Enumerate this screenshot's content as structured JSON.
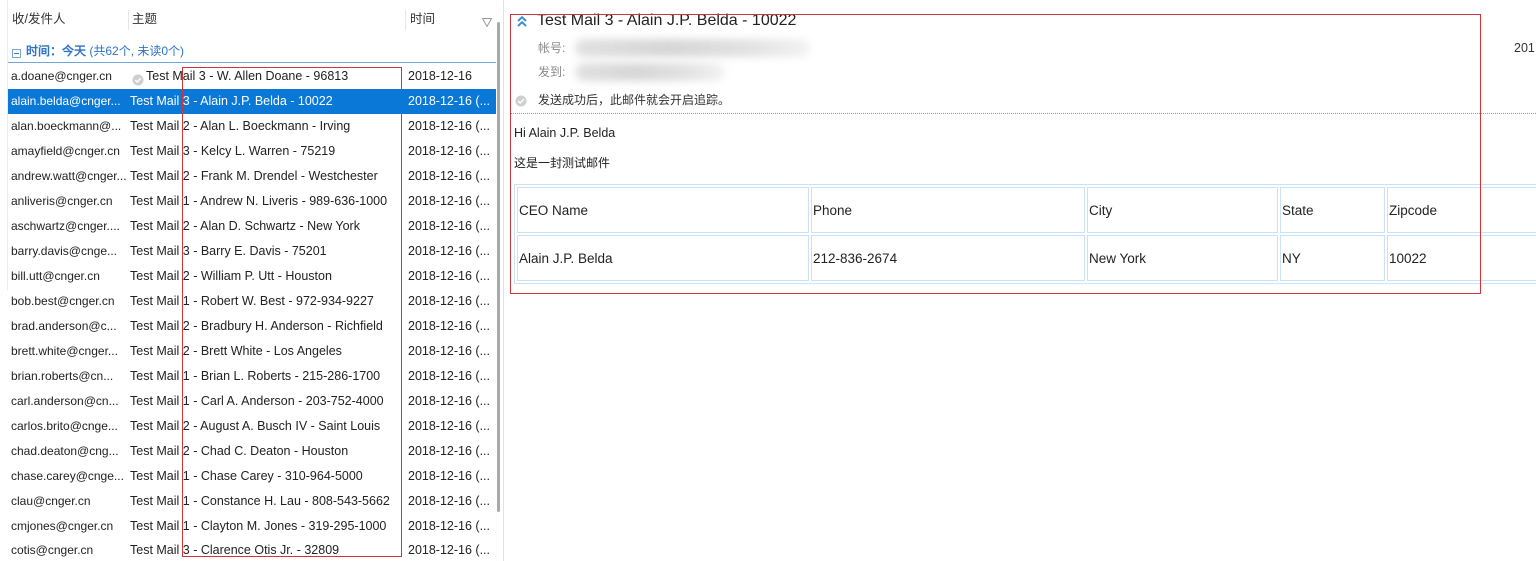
{
  "list": {
    "columns": {
      "sender": "收/发件人",
      "subject": "主题",
      "time": "时间"
    },
    "group": {
      "label": "时间：今天",
      "summary": " (共62个, 未读0个)"
    },
    "rows": [
      {
        "sender": "a.doane@cnger.cn",
        "subject": "Test Mail 3 - W. Allen Doane - 96813",
        "time": "2018-12-16"
      },
      {
        "sender": "alain.belda@cnger...",
        "subject": "Test Mail 3 - Alain J.P. Belda - 10022",
        "time": "2018-12-16 (...",
        "selected": true
      },
      {
        "sender": "alan.boeckmann@...",
        "subject": "Test Mail 2 - Alan L. Boeckmann - Irving",
        "time": "2018-12-16 (..."
      },
      {
        "sender": "amayfield@cnger.cn",
        "subject": "Test Mail 3 - Kelcy L. Warren - 75219",
        "time": "2018-12-16 (..."
      },
      {
        "sender": "andrew.watt@cnger...",
        "subject": "Test Mail 2 - Frank M. Drendel - Westchester",
        "time": "2018-12-16 (..."
      },
      {
        "sender": "anliveris@cnger.cn",
        "subject": "Test Mail 1 - Andrew N. Liveris - 989-636-1000",
        "time": "2018-12-16 (..."
      },
      {
        "sender": "aschwartz@cnger....",
        "subject": "Test Mail 2 - Alan D. Schwartz - New York",
        "time": "2018-12-16 (..."
      },
      {
        "sender": "barry.davis@cnge...",
        "subject": "Test Mail 3 - Barry E. Davis - 75201",
        "time": "2018-12-16 (..."
      },
      {
        "sender": "bill.utt@cnger.cn",
        "subject": "Test Mail 2 - William P. Utt - Houston",
        "time": "2018-12-16 (..."
      },
      {
        "sender": "bob.best@cnger.cn",
        "subject": "Test Mail 1 - Robert W. Best - 972-934-9227",
        "time": "2018-12-16 (..."
      },
      {
        "sender": "brad.anderson@c...",
        "subject": "Test Mail 2 - Bradbury H. Anderson - Richfield",
        "time": "2018-12-16 (..."
      },
      {
        "sender": "brett.white@cnger...",
        "subject": "Test Mail 2 - Brett White - Los Angeles",
        "time": "2018-12-16 (..."
      },
      {
        "sender": "brian.roberts@cn...",
        "subject": "Test Mail 1 - Brian L. Roberts - 215-286-1700",
        "time": "2018-12-16 (..."
      },
      {
        "sender": "carl.anderson@cn...",
        "subject": "Test Mail 1 - Carl A. Anderson - 203-752-4000",
        "time": "2018-12-16 (..."
      },
      {
        "sender": "carlos.brito@cnge...",
        "subject": "Test Mail 2 - August A. Busch IV - Saint Louis",
        "time": "2018-12-16 (..."
      },
      {
        "sender": "chad.deaton@cng...",
        "subject": "Test Mail 2 - Chad C. Deaton - Houston",
        "time": "2018-12-16 (..."
      },
      {
        "sender": "chase.carey@cnge...",
        "subject": "Test Mail 1 - Chase Carey - 310-964-5000",
        "time": "2018-12-16 (..."
      },
      {
        "sender": "clau@cnger.cn",
        "subject": "Test Mail 1 - Constance H. Lau - 808-543-5662",
        "time": "2018-12-16 (..."
      },
      {
        "sender": "cmjones@cnger.cn",
        "subject": "Test Mail 1 - Clayton M. Jones - 319-295-1000",
        "time": "2018-12-16 (..."
      },
      {
        "sender": "cotis@cnger.cn",
        "subject": "Test Mail 3 - Clarence Otis Jr. - 32809",
        "time": "2018-12-16 (..."
      }
    ]
  },
  "reader": {
    "title": "Test Mail 3 - Alain J.P. Belda - 10022",
    "account_label": "帐号:",
    "to_label": "发到:",
    "date_partial": "201",
    "tracking_notice": "发送成功后，此邮件就会开启追踪。",
    "greeting": "Hi Alain J.P. Belda",
    "body_line": "这是一封测试邮件",
    "table": {
      "headers": [
        "CEO Name",
        "Phone",
        "City",
        "State",
        "Zipcode"
      ],
      "rows": [
        [
          "Alain J.P. Belda",
          "212-836-2674",
          "New York",
          "NY",
          "10022"
        ]
      ]
    }
  },
  "icons": {
    "column_filter": "filter-triangle-icon",
    "group_toggle": "collapse-box-icon",
    "read_status": "check-circle-icon",
    "header_collapse": "chevron-double-up-icon",
    "tracking_status": "check-circle-icon"
  },
  "colors": {
    "selection": "#0a78d7",
    "group_text": "#2f73c4",
    "group_rule": "#6fa6dc",
    "table_border": "#cbe2f6",
    "accent_icon": "#3a8ed6",
    "annotation": "#d0343c"
  }
}
